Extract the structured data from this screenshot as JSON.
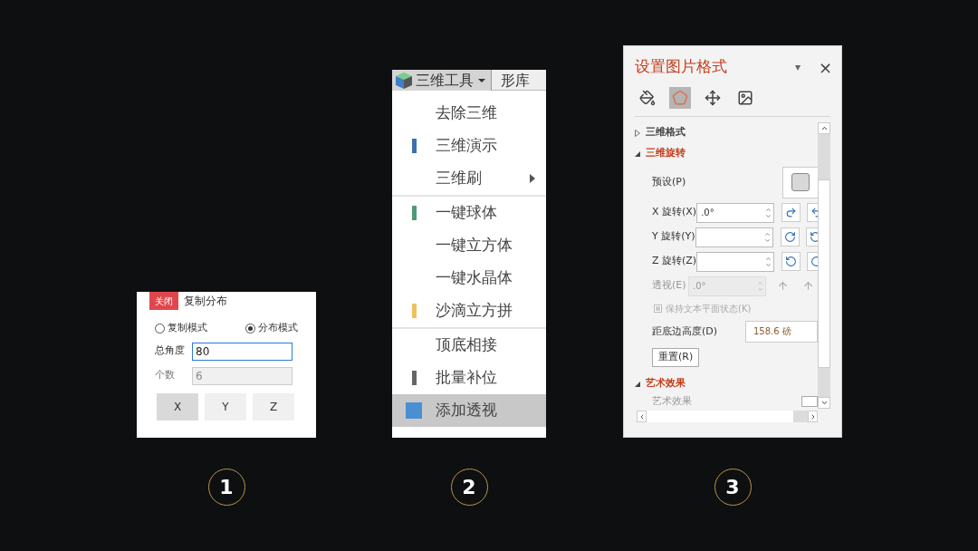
{
  "panel_1": {
    "close_button": "关闭",
    "title": "复制分布",
    "modes": [
      {
        "label": "复制模式",
        "selected": false
      },
      {
        "label": "分布模式",
        "selected": true
      }
    ],
    "fields": [
      {
        "label": "总角度",
        "value": "80",
        "disabled": false,
        "focused": true
      },
      {
        "label": "个数",
        "value": "6",
        "disabled": true,
        "focused": false
      }
    ],
    "axis_buttons": [
      {
        "label": "X",
        "selected": true
      },
      {
        "label": "Y",
        "selected": false
      },
      {
        "label": "Z",
        "selected": false
      }
    ]
  },
  "panel_2": {
    "menu_button": "三维工具",
    "next_tab": "形库",
    "items": [
      {
        "label": "去除三维",
        "selected": false,
        "submenu": false,
        "separator_after": false
      },
      {
        "label": "三维演示",
        "color": "#3d6fb0",
        "selected": false,
        "submenu": false,
        "separator_after": false
      },
      {
        "label": "三维刷",
        "selected": false,
        "submenu": true,
        "separator_after": true
      },
      {
        "label": "一键球体",
        "color": "#4f9a78",
        "selected": false,
        "submenu": false,
        "separator_after": false
      },
      {
        "label": "一键立方体",
        "selected": false,
        "submenu": false,
        "separator_after": false
      },
      {
        "label": "一键水晶体",
        "selected": false,
        "submenu": false,
        "separator_after": false
      },
      {
        "label": "沙滴立方拼",
        "color": "#f0c060",
        "selected": false,
        "submenu": false,
        "separator_after": true
      },
      {
        "label": "顶底相接",
        "selected": false,
        "submenu": false,
        "separator_after": false
      },
      {
        "label": "批量补位",
        "color": "#666666",
        "selected": false,
        "submenu": false,
        "separator_after": false
      },
      {
        "label": "添加透视",
        "color": "#4a8fd4",
        "selected": true,
        "submenu": false,
        "separator_after": false
      }
    ]
  },
  "panel_3": {
    "title": "设置图片格式",
    "dropdown": "▾",
    "close": "×",
    "tabs": [
      {
        "selected": false
      },
      {
        "selected": true
      },
      {
        "selected": false
      },
      {
        "selected": false
      }
    ],
    "sections": [
      {
        "title": "三维格式",
        "expanded": false
      },
      {
        "title": "三维旋转",
        "expanded": true,
        "rows": [
          {
            "kind": "preset",
            "label": "预设(P)"
          },
          {
            "kind": "spin",
            "label": "X 旋转(X)",
            "value": ".0°",
            "disabled": false
          },
          {
            "kind": "spin",
            "label": "Y 旋转(Y)",
            "disabled": false
          },
          {
            "kind": "spin",
            "label": "Z 旋转(Z)",
            "disabled": false
          },
          {
            "kind": "spin",
            "label": "透视(E)",
            "value": ".0°",
            "disabled": true
          },
          {
            "kind": "checkbox",
            "label": "保持文本平面状态(K)",
            "checked": false,
            "disabled": true
          },
          {
            "kind": "input",
            "label": "距底边高度(D)",
            "value": "158.6 磅"
          },
          {
            "kind": "button",
            "label": "重置(R)"
          }
        ]
      },
      {
        "title": "艺术效果",
        "expanded": true,
        "rows": [
          {
            "kind": "preset_small",
            "label": "艺术效果"
          }
        ]
      }
    ]
  },
  "badges": [
    "1",
    "2",
    "3"
  ]
}
